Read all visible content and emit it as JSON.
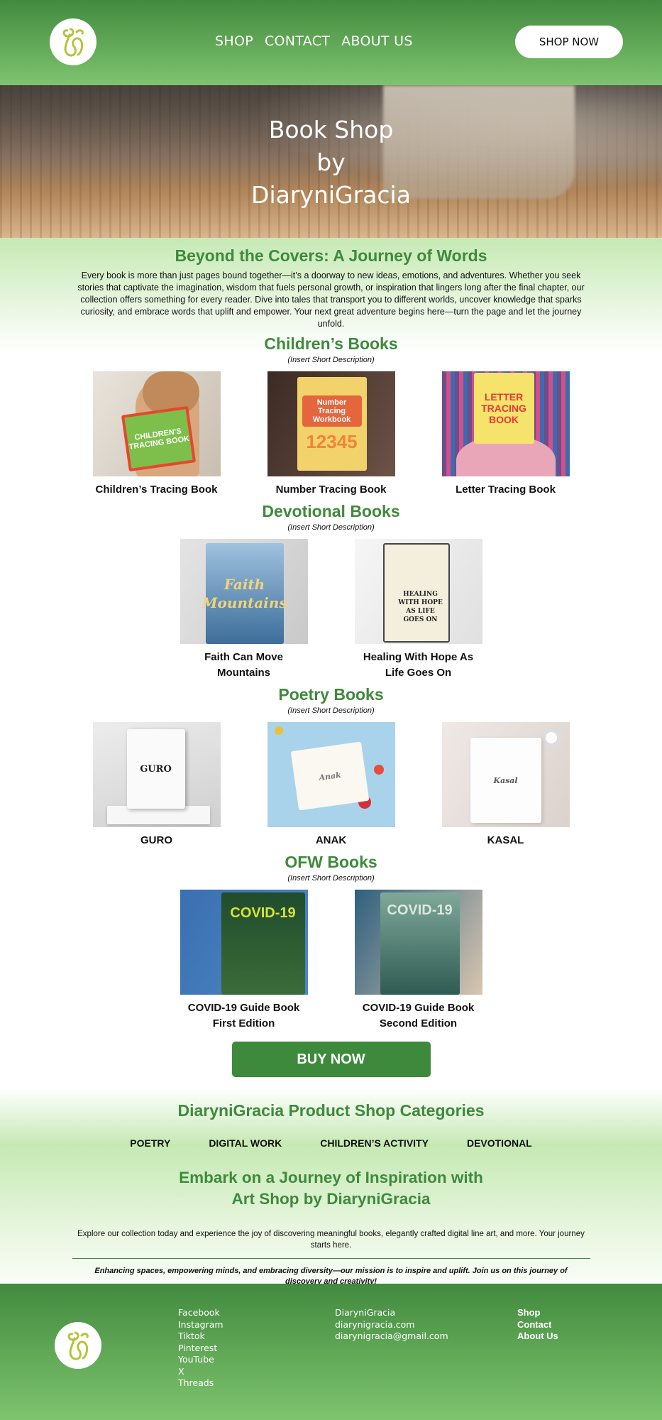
{
  "header": {
    "nav": [
      "SHOP",
      "CONTACT",
      "ABOUT US"
    ],
    "cta_label": "SHOP NOW"
  },
  "hero": {
    "title_lines": [
      "Book Shop",
      "by",
      "DiaryniGracia"
    ]
  },
  "intro": {
    "title": "Beyond the Covers: A Journey of Words",
    "text": "Every book is more than just pages bound together—it’s a doorway to new ideas, emotions, and adventures. Whether you seek stories that captivate the imagination, wisdom that fuels personal growth, or inspiration that lingers long after the final chapter, our collection offers something for every reader. Dive into tales that transport you to different worlds, uncover knowledge that sparks curiosity, and embrace words that uplift and empower. Your next great adventure begins here—turn the page and let the journey unfold."
  },
  "sections": [
    {
      "title": "Children’s Books",
      "description": "(Insert Short Description)",
      "items": [
        {
          "name": "Children’s Tracing Book",
          "cover_text": "CHILDREN'S TRACING BOOK"
        },
        {
          "name": "Number Tracing Book",
          "cover_text": "Number Tracing Workbook"
        },
        {
          "name": "Letter Tracing Book",
          "cover_text": "LETTER TRACING BOOK"
        }
      ]
    },
    {
      "title": "Devotional Books",
      "description": "(Insert Short Description)",
      "items": [
        {
          "name": "Faith Can Move Mountains",
          "cover_text": "Faith Mountains"
        },
        {
          "name": "Healing With Hope As Life Goes On",
          "cover_text": "HEALING WITH HOPE AS LIFE GOES ON"
        }
      ]
    },
    {
      "title": "Poetry Books",
      "description": "(Insert Short Description)",
      "items": [
        {
          "name": "GURO",
          "cover_text": "GURO"
        },
        {
          "name": "ANAK",
          "cover_text": "Anak"
        },
        {
          "name": "KASAL",
          "cover_text": "Kasal"
        }
      ]
    },
    {
      "title": "OFW Books",
      "description": "(Insert Short Description)",
      "items": [
        {
          "name": "COVID-19 Guide Book First Edition",
          "cover_text": "COVID-19"
        },
        {
          "name": "COVID-19 Guide Book Second Edition",
          "cover_text": "COVID-19"
        }
      ]
    }
  ],
  "buy_label": "BUY NOW",
  "categories": {
    "title": "DiaryniGracia Product Shop Categories",
    "items": [
      "POETRY",
      "DIGITAL WORK",
      "CHILDREN’S ACTIVITY",
      "DEVOTIONAL"
    ]
  },
  "embark": {
    "title_line1": "Embark on a Journey of Inspiration with",
    "title_line2": "Art Shop by DiaryniGracia",
    "text": "Explore our collection today and experience the joy of discovering meaningful books, elegantly crafted digital line art, and more. Your journey starts here.",
    "mission": "Enhancing spaces, empowering minds, and embracing diversity—our mission is to inspire and uplift. Join us on this journey of discovery and creativity!"
  },
  "footer": {
    "social": [
      "Facebook",
      "Instagram",
      "Tiktok",
      "Pinterest",
      "YouTube",
      "X",
      "Threads"
    ],
    "contact": [
      "DiaryniGracia",
      "diarynigracia.com",
      "diarynigracia@gmail.com"
    ],
    "links": [
      "Shop",
      "Contact",
      "About Us"
    ]
  },
  "colors": {
    "brand_green": "#3e8a3c",
    "header_top": "#428a3e",
    "header_bottom": "#7ec46f",
    "logo_mark": "#b6c23a"
  }
}
